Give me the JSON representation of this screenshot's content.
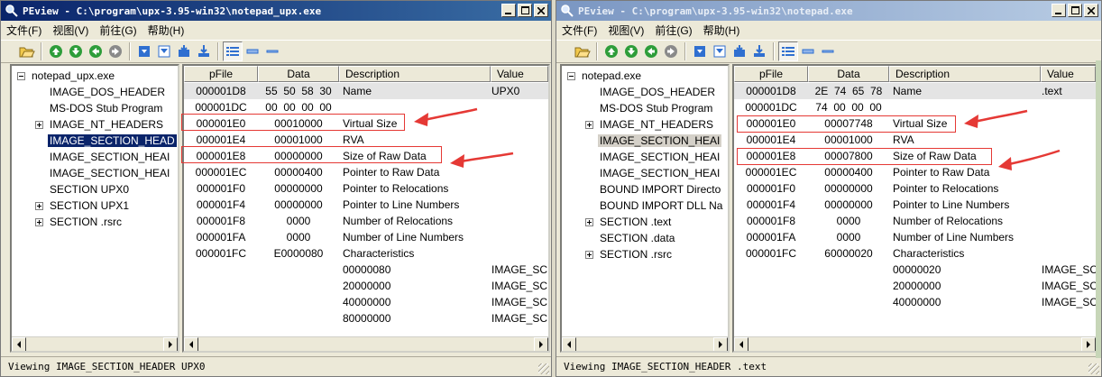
{
  "left_window": {
    "title": "PEview - C:\\program\\upx-3.95-win32\\notepad_upx.exe",
    "menu": [
      "文件(F)",
      "视图(V)",
      "前往(G)",
      "帮助(H)"
    ],
    "tree": [
      {
        "label": "notepad_upx.exe",
        "expander": "minus"
      },
      {
        "label": "IMAGE_DOS_HEADER",
        "expander": ""
      },
      {
        "label": "MS-DOS Stub Program",
        "expander": ""
      },
      {
        "label": "IMAGE_NT_HEADERS",
        "expander": "plus"
      },
      {
        "label": "IMAGE_SECTION_HEAD",
        "expander": "",
        "selected": true
      },
      {
        "label": "IMAGE_SECTION_HEAI",
        "expander": ""
      },
      {
        "label": "IMAGE_SECTION_HEAI",
        "expander": ""
      },
      {
        "label": "SECTION UPX0",
        "expander": ""
      },
      {
        "label": "SECTION UPX1",
        "expander": "plus"
      },
      {
        "label": "SECTION .rsrc",
        "expander": "plus"
      }
    ],
    "columns": [
      "pFile",
      "Data",
      "Description",
      "Value"
    ],
    "rows": [
      {
        "pfile": "000001D8",
        "data": "55  50  58  30",
        "desc": "Name",
        "value": "UPX0",
        "hl": true
      },
      {
        "pfile": "000001DC",
        "data": "00  00  00  00",
        "desc": "",
        "value": ""
      },
      {
        "pfile": "000001E0",
        "data": "00010000",
        "desc": "Virtual Size",
        "value": ""
      },
      {
        "pfile": "000001E4",
        "data": "00001000",
        "desc": "RVA",
        "value": ""
      },
      {
        "pfile": "000001E8",
        "data": "00000000",
        "desc": "Size of Raw Data",
        "value": ""
      },
      {
        "pfile": "000001EC",
        "data": "00000400",
        "desc": "Pointer to Raw Data",
        "value": ""
      },
      {
        "pfile": "000001F0",
        "data": "00000000",
        "desc": "Pointer to Relocations",
        "value": ""
      },
      {
        "pfile": "000001F4",
        "data": "00000000",
        "desc": "Pointer to Line Numbers",
        "value": ""
      },
      {
        "pfile": "000001F8",
        "data": "0000",
        "desc": "Number of Relocations",
        "value": ""
      },
      {
        "pfile": "000001FA",
        "data": "0000",
        "desc": "Number of Line Numbers",
        "value": ""
      },
      {
        "pfile": "000001FC",
        "data": "E0000080",
        "desc": "Characteristics",
        "value": ""
      },
      {
        "pfile": "",
        "data": "",
        "desc": "00000080",
        "value": "IMAGE_SC"
      },
      {
        "pfile": "",
        "data": "",
        "desc": "20000000",
        "value": "IMAGE_SC"
      },
      {
        "pfile": "",
        "data": "",
        "desc": "40000000",
        "value": "IMAGE_SC"
      },
      {
        "pfile": "",
        "data": "",
        "desc": "80000000",
        "value": "IMAGE_SC"
      }
    ],
    "status": "Viewing IMAGE_SECTION_HEADER UPX0"
  },
  "right_window": {
    "title": "PEview - C:\\program\\upx-3.95-win32\\notepad.exe",
    "menu": [
      "文件(F)",
      "视图(V)",
      "前往(G)",
      "帮助(H)"
    ],
    "tree": [
      {
        "label": "notepad.exe",
        "expander": "minus"
      },
      {
        "label": "IMAGE_DOS_HEADER",
        "expander": ""
      },
      {
        "label": "MS-DOS Stub Program",
        "expander": ""
      },
      {
        "label": "IMAGE_NT_HEADERS",
        "expander": "plus"
      },
      {
        "label": "IMAGE_SECTION_HEAI",
        "expander": "",
        "selected": true
      },
      {
        "label": "IMAGE_SECTION_HEAI",
        "expander": ""
      },
      {
        "label": "IMAGE_SECTION_HEAI",
        "expander": ""
      },
      {
        "label": "BOUND IMPORT Directo",
        "expander": ""
      },
      {
        "label": "BOUND IMPORT DLL Na",
        "expander": ""
      },
      {
        "label": "SECTION .text",
        "expander": "plus"
      },
      {
        "label": "SECTION .data",
        "expander": ""
      },
      {
        "label": "SECTION .rsrc",
        "expander": "plus"
      }
    ],
    "columns": [
      "pFile",
      "Data",
      "Description",
      "Value"
    ],
    "rows": [
      {
        "pfile": "000001D8",
        "data": "2E  74  65  78",
        "desc": "Name",
        "value": ".text",
        "hl": true
      },
      {
        "pfile": "000001DC",
        "data": "74  00  00  00",
        "desc": "",
        "value": ""
      },
      {
        "pfile": "000001E0",
        "data": "00007748",
        "desc": "Virtual Size",
        "value": ""
      },
      {
        "pfile": "000001E4",
        "data": "00001000",
        "desc": "RVA",
        "value": ""
      },
      {
        "pfile": "000001E8",
        "data": "00007800",
        "desc": "Size of Raw Data",
        "value": ""
      },
      {
        "pfile": "000001EC",
        "data": "00000400",
        "desc": "Pointer to Raw Data",
        "value": ""
      },
      {
        "pfile": "000001F0",
        "data": "00000000",
        "desc": "Pointer to Relocations",
        "value": ""
      },
      {
        "pfile": "000001F4",
        "data": "00000000",
        "desc": "Pointer to Line Numbers",
        "value": ""
      },
      {
        "pfile": "000001F8",
        "data": "0000",
        "desc": "Number of Relocations",
        "value": ""
      },
      {
        "pfile": "000001FA",
        "data": "0000",
        "desc": "Number of Line Numbers",
        "value": ""
      },
      {
        "pfile": "000001FC",
        "data": "60000020",
        "desc": "Characteristics",
        "value": ""
      },
      {
        "pfile": "",
        "data": "",
        "desc": "00000020",
        "value": "IMAGE_SC"
      },
      {
        "pfile": "",
        "data": "",
        "desc": "20000000",
        "value": "IMAGE_SC"
      },
      {
        "pfile": "",
        "data": "",
        "desc": "40000000",
        "value": "IMAGE_SC"
      }
    ],
    "status": "Viewing IMAGE_SECTION_HEADER .text"
  },
  "colors": {
    "title_active": "#0a246a",
    "annotation_red": "#e53935",
    "selection": "#0a246a"
  },
  "icons": [
    "magnifier-app-icon",
    "open-folder-icon",
    "green-up-icon",
    "green-down-icon",
    "green-back-icon",
    "gray-forward-icon",
    "save-blue-icon",
    "view-blue-icon",
    "address-icon",
    "list-view-icon"
  ]
}
